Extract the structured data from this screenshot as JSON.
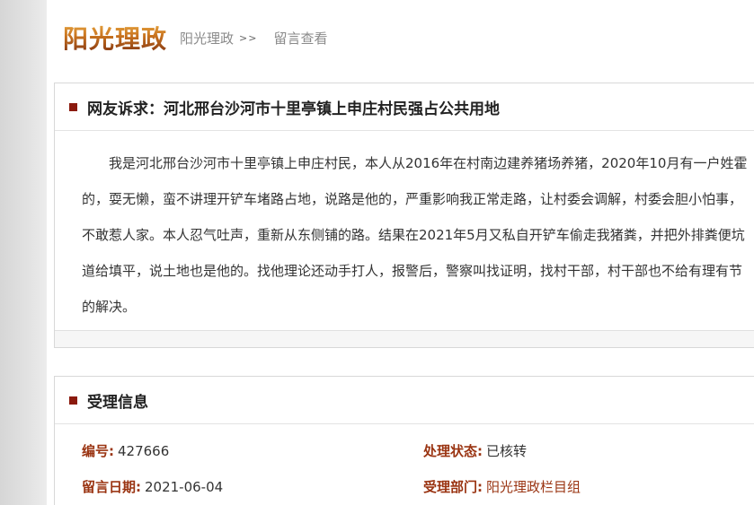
{
  "header": {
    "brand": "阳光理政",
    "breadcrumb": [
      {
        "label": "阳光理政",
        "sep": ">>"
      },
      {
        "label": "留言查看"
      }
    ]
  },
  "complaint": {
    "title": "网友诉求：河北邢台沙河市十里亭镇上申庄村民强占公共用地",
    "body": "我是河北邢台沙河市十里亭镇上申庄村民，本人从2016年在村南边建养猪场养猪，2020年10月有一户姓霍的，耍无懒，蛮不讲理开铲车堵路占地，说路是他的，严重影响我正常走路，让村委会调解，村委会胆小怕事，不敢惹人家。本人忍气吐声，重新从东侧铺的路。结果在2021年5月又私自开铲车偷走我猪粪，并把外排粪便坑道给填平，说土地也是他的。找他理论还动手打人，报警后，警察叫找证明，找村干部，村干部也不给有理有节的解决。"
  },
  "acceptance": {
    "title": "受理信息",
    "rows": [
      [
        {
          "label": "编号:",
          "value": "427666"
        },
        {
          "label": "处理状态:",
          "value": "已核转"
        }
      ],
      [
        {
          "label": "留言日期:",
          "value": "2021-06-04"
        },
        {
          "label": "受理部门:",
          "value": "阳光理政栏目组"
        }
      ]
    ]
  },
  "colors": {
    "accent": "#8b1a0e",
    "label": "#9a3412"
  }
}
